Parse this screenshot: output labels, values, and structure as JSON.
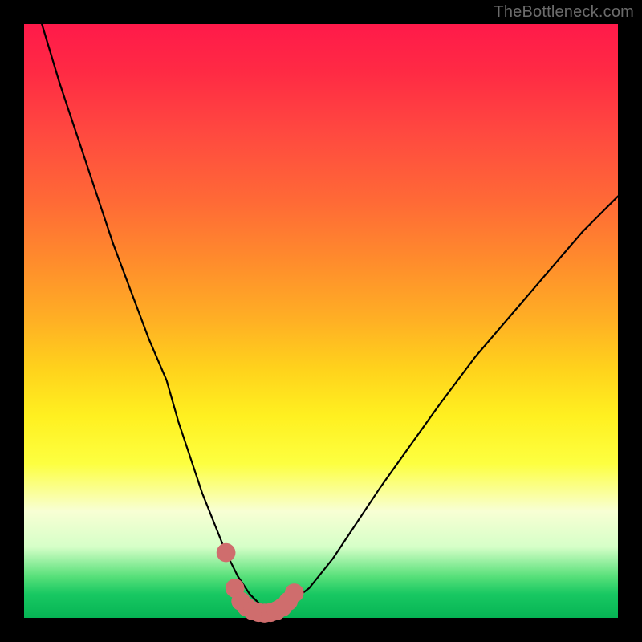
{
  "watermark": "TheBottleneck.com",
  "chart_data": {
    "type": "line",
    "title": "",
    "xlabel": "",
    "ylabel": "",
    "xlim": [
      0,
      100
    ],
    "ylim": [
      0,
      100
    ],
    "series": [
      {
        "name": "bottleneck-curve",
        "x": [
          3,
          6,
          9,
          12,
          15,
          18,
          21,
          24,
          26,
          28,
          30,
          32,
          34,
          36,
          38,
          40,
          42,
          44,
          48,
          52,
          56,
          60,
          65,
          70,
          76,
          82,
          88,
          94,
          100
        ],
        "y": [
          100,
          90,
          81,
          72,
          63,
          55,
          47,
          40,
          33,
          27,
          21,
          16,
          11,
          7,
          4,
          2,
          1,
          2,
          5,
          10,
          16,
          22,
          29,
          36,
          44,
          51,
          58,
          65,
          71
        ]
      }
    ],
    "highlight": {
      "name": "valley-highlight",
      "color": "#cf6d6d",
      "radius": 1.6,
      "points": [
        {
          "x": 34.0,
          "y": 11.0
        },
        {
          "x": 35.5,
          "y": 5.0
        },
        {
          "x": 36.5,
          "y": 2.8
        },
        {
          "x": 37.5,
          "y": 1.8
        },
        {
          "x": 38.5,
          "y": 1.2
        },
        {
          "x": 39.5,
          "y": 0.9
        },
        {
          "x": 40.5,
          "y": 0.8
        },
        {
          "x": 41.5,
          "y": 0.9
        },
        {
          "x": 42.5,
          "y": 1.2
        },
        {
          "x": 43.5,
          "y": 1.8
        },
        {
          "x": 44.5,
          "y": 2.8
        },
        {
          "x": 45.5,
          "y": 4.2
        }
      ]
    },
    "gradient_stops": [
      {
        "pos": 0,
        "color": "#ff1a4a"
      },
      {
        "pos": 8,
        "color": "#ff2a44"
      },
      {
        "pos": 18,
        "color": "#ff4840"
      },
      {
        "pos": 30,
        "color": "#ff6a36"
      },
      {
        "pos": 40,
        "color": "#ff8c2c"
      },
      {
        "pos": 50,
        "color": "#ffb024"
      },
      {
        "pos": 58,
        "color": "#ffd21c"
      },
      {
        "pos": 66,
        "color": "#fff020"
      },
      {
        "pos": 74,
        "color": "#fdff40"
      },
      {
        "pos": 82,
        "color": "#f8ffd4"
      },
      {
        "pos": 88,
        "color": "#d6ffc8"
      },
      {
        "pos": 93,
        "color": "#58e07a"
      },
      {
        "pos": 96,
        "color": "#18c862"
      },
      {
        "pos": 100,
        "color": "#06b454"
      }
    ]
  }
}
